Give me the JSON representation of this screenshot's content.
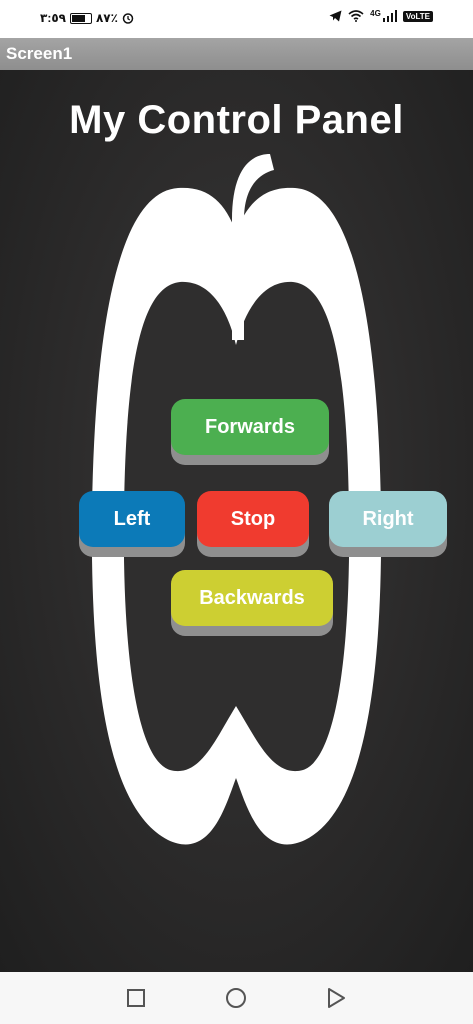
{
  "status_bar": {
    "time": "٣:٥٩",
    "battery": "٨٧٪",
    "network": "4G",
    "volte": "VoLTE"
  },
  "app": {
    "screen_title": "Screen1",
    "panel_title": "My Control Panel"
  },
  "controls": {
    "forwards": "Forwards",
    "left": "Left",
    "stop": "Stop",
    "right": "Right",
    "backwards": "Backwards"
  },
  "colors": {
    "forwards": "#4caf50",
    "left": "#0c7ab8",
    "stop": "#f03b2f",
    "right": "#9ccfd2",
    "backwards": "#cdcf32"
  },
  "nav_icons": [
    "recent-apps-icon",
    "home-icon",
    "back-icon"
  ]
}
